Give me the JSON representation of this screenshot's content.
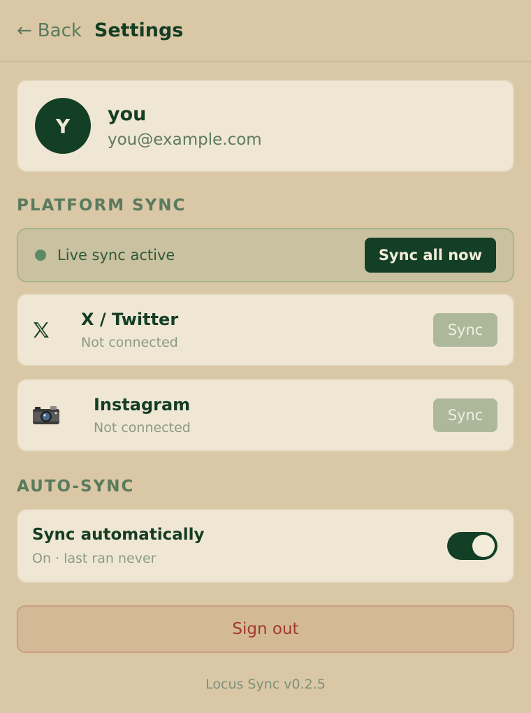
{
  "header": {
    "back_label": "Back",
    "title": "Settings"
  },
  "profile": {
    "avatar_initial": "Y",
    "name": "you",
    "email": "you@example.com"
  },
  "platform_sync": {
    "section_label": "PLATFORM SYNC",
    "live_status": "Live sync active",
    "sync_all_label": "Sync all now",
    "platforms": [
      {
        "name": "X / Twitter",
        "status": "Not connected",
        "sync_label": "Sync",
        "icon": "x-logo-icon"
      },
      {
        "name": "Instagram",
        "status": "Not connected",
        "sync_label": "Sync",
        "icon": "camera-icon"
      }
    ]
  },
  "auto_sync": {
    "section_label": "AUTO-SYNC",
    "title": "Sync automatically",
    "subtitle": "On · last ran never",
    "enabled": true
  },
  "sign_out_label": "Sign out",
  "version": "Locus Sync v0.2.5",
  "colors": {
    "background": "#d9c7a5",
    "card": "#efe7d4",
    "accent_dark_green": "#123f25",
    "sign_out_text": "#a23a2c"
  }
}
